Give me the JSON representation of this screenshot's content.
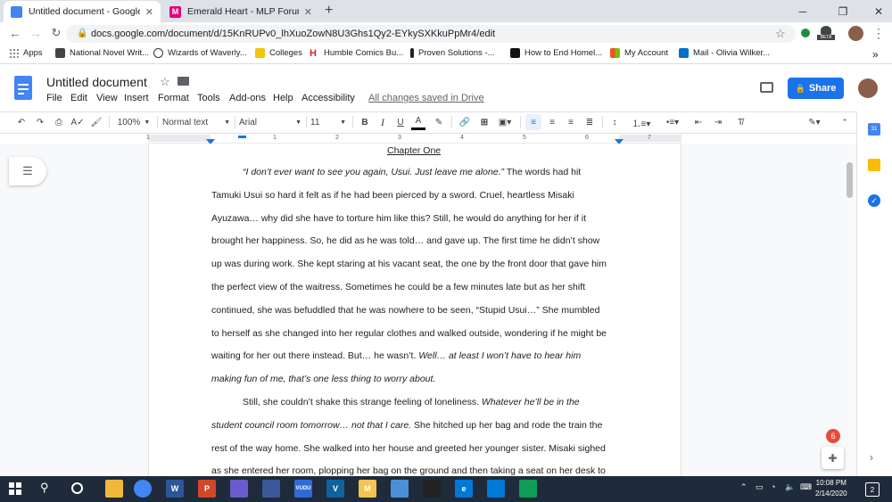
{
  "browser": {
    "tabs": [
      {
        "title": "Untitled document - Google Doc",
        "active": true,
        "icon": "google-docs-icon"
      },
      {
        "title": "Emerald Heart - MLP Forums",
        "active": false,
        "icon": "mlp-forums-icon"
      }
    ],
    "new_tab": "+",
    "url": "docs.google.com/document/d/15KnRUPv0_lhXuoZowN8U3Ghs1Qy2-EYkySXKkuPpMr4/edit",
    "beta_badge": "BETA",
    "bookmarks": [
      {
        "label": "Apps",
        "color": "#5f6368"
      },
      {
        "label": "National Novel Writ...",
        "color": "#444444"
      },
      {
        "label": "Wizards of Waverly...",
        "color": "#333333"
      },
      {
        "label": "Colleges",
        "color": "#f4c20d"
      },
      {
        "label": "Humble Comics Bu...",
        "color": "#cc2929"
      },
      {
        "label": "Proven Solutions -...",
        "color": "#222222"
      },
      {
        "label": "How to End Homel...",
        "color": "#111111"
      },
      {
        "label": "My Account",
        "color": "#f25022"
      },
      {
        "label": "Mail - Olivia Wilker...",
        "color": "#0072c6"
      }
    ],
    "bookmarks_more": "»"
  },
  "docs": {
    "title": "Untitled document",
    "menus": [
      "File",
      "Edit",
      "View",
      "Insert",
      "Format",
      "Tools",
      "Add-ons",
      "Help",
      "Accessibility"
    ],
    "saved_status": "All changes saved in Drive",
    "share_label": "Share",
    "toolbar": {
      "zoom": "100%",
      "style": "Normal text",
      "font": "Arial",
      "size": "11"
    },
    "ruler_numbers": [
      "1",
      "1",
      "2",
      "3",
      "4",
      "5",
      "6",
      "7"
    ],
    "chapter_title": "Chapter One",
    "lines": [
      {
        "indent": true,
        "segments": [
          {
            "t": "“I don’t ever want to see you again, Usui. Just leave me alone.”",
            "i": true
          },
          {
            "t": " The words had hit",
            "i": false
          }
        ]
      },
      {
        "indent": false,
        "segments": [
          {
            "t": "Tamuki Usui so hard it felt as if he had been pierced by a sword. Cruel, heartless Misaki",
            "i": false
          }
        ]
      },
      {
        "indent": false,
        "segments": [
          {
            "t": "Ayuzawa… why did she have to torture him like this? Still, he would do anything for her if it",
            "i": false
          }
        ]
      },
      {
        "indent": false,
        "segments": [
          {
            "t": "brought her happiness. So, he did as he was told… and gave up. The first time he didn’t show",
            "i": false
          }
        ]
      },
      {
        "indent": false,
        "segments": [
          {
            "t": "up was during work. She kept staring at his vacant seat, the one by the front door that gave him",
            "i": false
          }
        ]
      },
      {
        "indent": false,
        "segments": [
          {
            "t": "the perfect view of the waitress. Sometimes he could be a few minutes late but as her shift",
            "i": false
          }
        ]
      },
      {
        "indent": false,
        "segments": [
          {
            "t": "continued, she was befuddled that he was nowhere to be seen, “Stupid Usui…” She mumbled",
            "i": false
          }
        ]
      },
      {
        "indent": false,
        "segments": [
          {
            "t": "to herself as she changed into her regular clothes and walked outside, wondering if he might be",
            "i": false
          }
        ]
      },
      {
        "indent": false,
        "segments": [
          {
            "t": "waiting for her out there instead. But… he wasn’t. ",
            "i": false
          },
          {
            "t": "Well… at least I won’t have to hear him",
            "i": true
          }
        ]
      },
      {
        "indent": false,
        "segments": [
          {
            "t": "making fun of me, that’s one less thing to worry about.",
            "i": true
          }
        ]
      },
      {
        "indent": true,
        "segments": [
          {
            "t": "Still, she couldn’t shake this strange feeling of loneliness. ",
            "i": false
          },
          {
            "t": "Whatever he’ll be in the",
            "i": true
          }
        ]
      },
      {
        "indent": false,
        "segments": [
          {
            "t": "student council room tomorrow… not that I care.",
            "i": true
          },
          {
            "t": " She hitched up her bag and rode the train the",
            "i": false
          }
        ]
      },
      {
        "indent": false,
        "segments": [
          {
            "t": "rest of the way home. She walked into her house and greeted her younger sister. Misaki sighed",
            "i": false
          }
        ]
      },
      {
        "indent": false,
        "segments": [
          {
            "t": "as she entered her room, plopping her bag on the ground and then taking a seat on her desk to",
            "i": false
          }
        ]
      }
    ],
    "notification_count": "6"
  },
  "taskbar": {
    "apps": [
      {
        "name": "file-explorer",
        "color": "#f0b73a",
        "label": ""
      },
      {
        "name": "chrome",
        "color": "#4285f4",
        "label": ""
      },
      {
        "name": "word",
        "color": "#2b579a",
        "label": "W"
      },
      {
        "name": "powerpoint",
        "color": "#d24726",
        "label": "P"
      },
      {
        "name": "app-5",
        "color": "#6a5acd",
        "label": ""
      },
      {
        "name": "app-6",
        "color": "#3b5998",
        "label": ""
      },
      {
        "name": "vudu",
        "color": "#2e6bd6",
        "label": "VUDU"
      },
      {
        "name": "app-v",
        "color": "#0e639c",
        "label": "V"
      },
      {
        "name": "app-m",
        "color": "#f6c453",
        "label": "M"
      },
      {
        "name": "app-10",
        "color": "#4a90d9",
        "label": ""
      },
      {
        "name": "app-11",
        "color": "#222222",
        "label": ""
      },
      {
        "name": "edge",
        "color": "#0078d7",
        "label": "e"
      },
      {
        "name": "app-13",
        "color": "#0078d7",
        "label": ""
      },
      {
        "name": "hangouts",
        "color": "#0f9d58",
        "label": ""
      }
    ],
    "time": "10:08 PM",
    "date": "2/14/2020",
    "notification_badge": "2"
  }
}
